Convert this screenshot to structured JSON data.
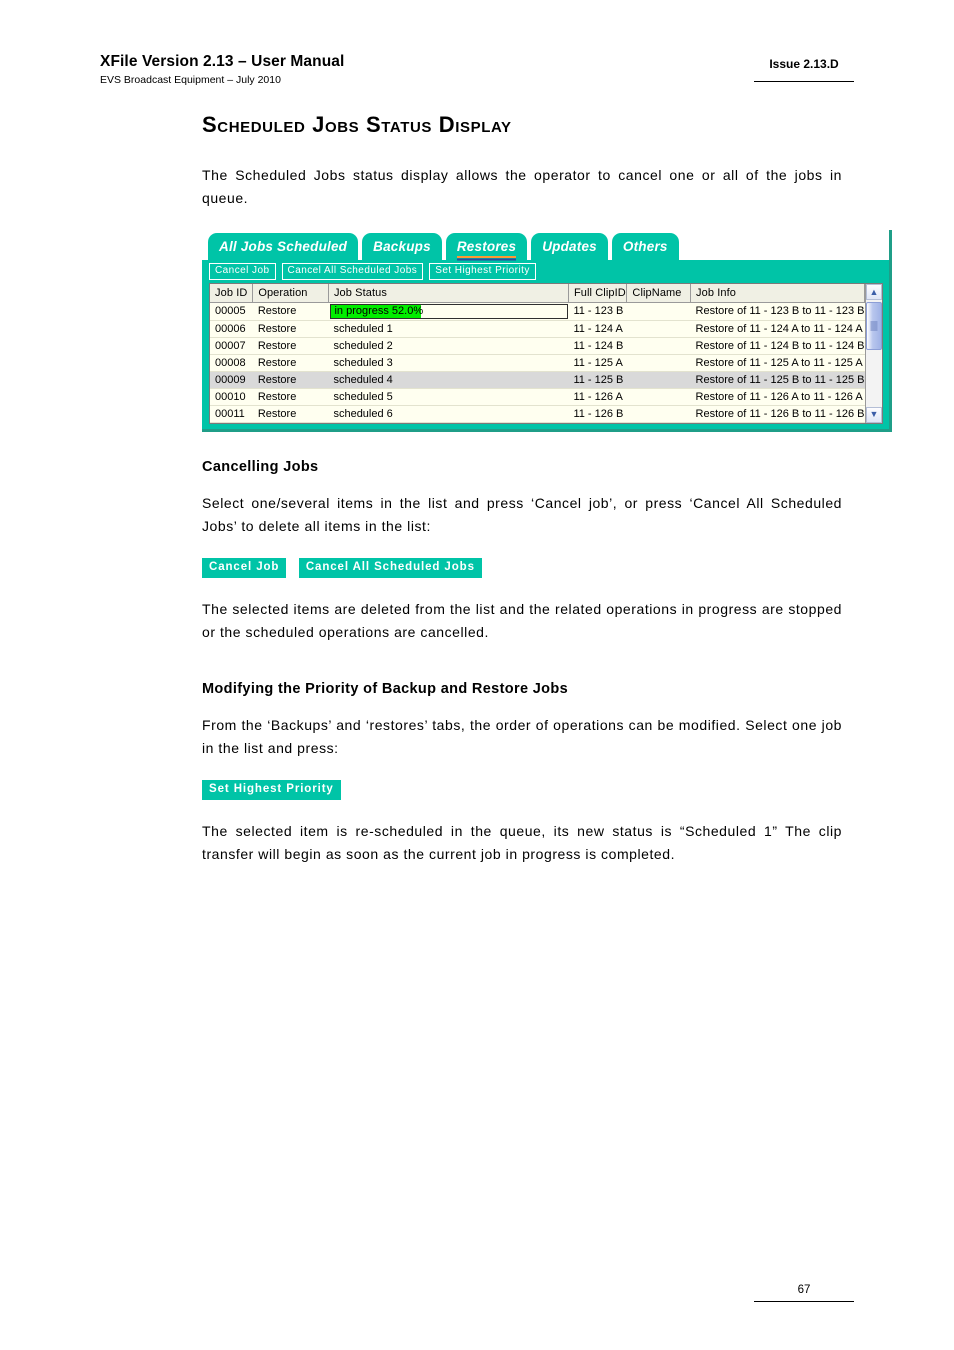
{
  "header": {
    "title": "XFile Version 2.13 – User Manual",
    "subtitle": "EVS Broadcast Equipment – July 2010",
    "issue": "Issue 2.13.D"
  },
  "footer": {
    "page_number": "67"
  },
  "doc": {
    "title": "Scheduled Jobs Status Display",
    "intro": "The Scheduled Jobs status display allows the operator to cancel one or all of the jobs in queue.",
    "sections": [
      {
        "heading": "Cancelling Jobs",
        "para_before": "Select one/several items in the list and press ‘Cancel job’, or press ‘Cancel All Scheduled Jobs’ to delete all items in the list:",
        "para_after": "The selected items are deleted from the list and the related operations in progress are stopped or the scheduled operations are cancelled."
      },
      {
        "heading": "Modifying the Priority of Backup and Restore Jobs",
        "para_before": "From the ‘Backups’ and ‘restores’ tabs, the order of operations can be modified. Select one job in the list and press:",
        "para_after": "The selected item is re-scheduled in the queue, its new status is “Scheduled 1” The clip transfer will begin as soon as the current job in progress is completed."
      }
    ]
  },
  "figures": {
    "cancel_buttons": [
      {
        "label": "Cancel Job"
      },
      {
        "label": "Cancel All Scheduled Jobs"
      }
    ],
    "priority_button": {
      "label": "Set Highest Priority"
    }
  },
  "screenshot": {
    "tabs": [
      {
        "label": "All Jobs Scheduled",
        "selected": false
      },
      {
        "label": "Backups",
        "selected": false
      },
      {
        "label": "Restores",
        "selected": true
      },
      {
        "label": "Updates",
        "selected": false
      },
      {
        "label": "Others",
        "selected": false
      }
    ],
    "toolbar": [
      {
        "label": "Cancel Job"
      },
      {
        "label": "Cancel All Scheduled Jobs"
      },
      {
        "label": "Set Highest Priority"
      }
    ],
    "columns": [
      "Job ID",
      "Operation",
      "Job Status",
      "Full ClipID",
      "ClipName",
      "Job Info"
    ],
    "rows": [
      {
        "job_id": "00005",
        "operation": "Restore",
        "status": "in progress 52.0",
        "status_suffix": "%",
        "progress_percent": 52.0,
        "is_progress": true,
        "full_clipid": "11 - 123 B",
        "clipname": "",
        "job_info": "Restore of 11 - 123 B to 11 - 123 B",
        "selected": false
      },
      {
        "job_id": "00006",
        "operation": "Restore",
        "status": "scheduled 1",
        "is_progress": false,
        "full_clipid": "11 - 124 A",
        "clipname": "",
        "job_info": "Restore of 11 - 124 A to 11 - 124 A",
        "selected": false
      },
      {
        "job_id": "00007",
        "operation": "Restore",
        "status": "scheduled 2",
        "is_progress": false,
        "full_clipid": "11 - 124 B",
        "clipname": "",
        "job_info": "Restore of 11 - 124 B to 11 - 124 B",
        "selected": false
      },
      {
        "job_id": "00008",
        "operation": "Restore",
        "status": "scheduled 3",
        "is_progress": false,
        "full_clipid": "11 - 125 A",
        "clipname": "",
        "job_info": "Restore of 11 - 125 A to 11 - 125 A",
        "selected": false
      },
      {
        "job_id": "00009",
        "operation": "Restore",
        "status": "scheduled 4",
        "is_progress": false,
        "full_clipid": "11 - 125 B",
        "clipname": "",
        "job_info": "Restore of 11 - 125 B to 11 - 125 B",
        "selected": true
      },
      {
        "job_id": "00010",
        "operation": "Restore",
        "status": "scheduled 5",
        "is_progress": false,
        "full_clipid": "11 - 126 A",
        "clipname": "",
        "job_info": "Restore of 11 - 126 A to 11 - 126 A",
        "selected": false
      },
      {
        "job_id": "00011",
        "operation": "Restore",
        "status": "scheduled 6",
        "is_progress": false,
        "full_clipid": "11 - 126 B",
        "clipname": "",
        "job_info": "Restore of 11 - 126 B to 11 - 126 B",
        "selected": false
      }
    ],
    "scrollbar": {
      "up_arrow": "scroll-up-icon",
      "down_arrow": "scroll-down-icon"
    },
    "colors": {
      "teal": "#00c4a7",
      "progress_green": "#00ee00",
      "grid_background": "#fffff0",
      "selected_row": "#d9d9d9",
      "tab_underline": "#ff9933"
    }
  }
}
